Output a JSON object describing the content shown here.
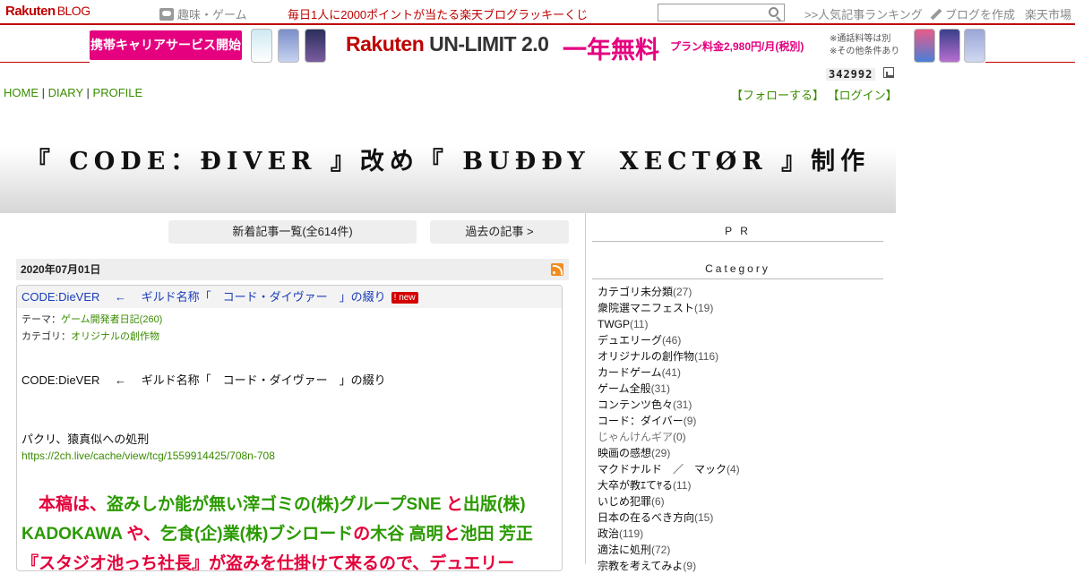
{
  "topbar": {
    "logo_main": "Rakuten",
    "logo_sub": "BLOG",
    "hobby": "趣味・ゲーム",
    "lucky": "毎日1人に2000ポイントが当たる楽天ブログラッキーくじ",
    "search_value": "",
    "ranking": ">>人気記事ランキング",
    "create": "ブログを作成",
    "ichiba": "楽天市場"
  },
  "ad": {
    "tag": "携帯キャリアサービス開始",
    "brand_a": "Rakuten ",
    "brand_b": "UN-LIMIT 2.0",
    "free": "一年無料",
    "price": "プラン料金2,980円/月(税別)",
    "note1": "※通話料等は別",
    "note2": "※その他条件あり"
  },
  "counter": "342992",
  "nav": {
    "home": "HOME",
    "diary": "DIARY",
    "profile": "PROFILE",
    "sep": "|",
    "follow": "【フォローする】",
    "login": "【ログイン】"
  },
  "blog_title": "『 CODE：ÐIVER 』改め『 BUÐÐY　XECTØR 』制作",
  "buttons": {
    "new_posts": "新着記事一覧(全614件)",
    "past_posts": "過去の記事 >"
  },
  "post": {
    "date": "2020年07月01日",
    "title": "CODE:DieVER　 ←　 ギルド名称「　コード・ダイヴァー　」の綴り",
    "new_label": "! new",
    "theme_label": "テーマ：",
    "theme": "ゲーム開発者日記(260)",
    "category_label": "カテゴリ：",
    "category": "オリジナルの創作物",
    "line1": "CODE:DieVER　 ←　 ギルド名称「　コード・ダイヴァー　」の綴り",
    "line2": "パクリ、猿真似への処刑",
    "link": "https://2ch.live/cache/view/tcg/1559914425/708n-708",
    "big_segments": [
      {
        "text": "　本稿は、",
        "color": "red"
      },
      {
        "text": "盗みしか能が無い滓ゴミの(株)グループSNE",
        "color": "green"
      },
      {
        "text": " と",
        "color": "red"
      },
      {
        "text": "出版(株) KADOKAWA",
        "color": "green"
      },
      {
        "text": " や、",
        "color": "red"
      },
      {
        "text": "乞食(企)業(株)ブシロード",
        "color": "green"
      },
      {
        "text": "の",
        "color": "red"
      },
      {
        "text": "木谷 高明",
        "color": "green"
      },
      {
        "text": "と",
        "color": "red"
      },
      {
        "text": "池田 芳正",
        "color": "green"
      },
      {
        "text": "『スタジオ池っち社長』が盗みを仕掛けて来るので、デュエリー",
        "color": "red"
      }
    ]
  },
  "sidebar": {
    "pr": "P R",
    "category_head": "Category",
    "categories": [
      {
        "name": "カテゴリ未分類",
        "count": "(27)"
      },
      {
        "name": "衆院選マニフェスト",
        "count": "(19)"
      },
      {
        "name": "TWGP",
        "count": "(11)"
      },
      {
        "name": "デュエリーグ",
        "count": "(46)"
      },
      {
        "name": "オリジナルの創作物",
        "count": "(116)"
      },
      {
        "name": "カードゲーム",
        "count": "(41)"
      },
      {
        "name": "ゲーム全般",
        "count": "(31)"
      },
      {
        "name": "コンテンツ色々",
        "count": "(31)"
      },
      {
        "name": "コード：ダイバー",
        "count": "(9)"
      },
      {
        "name": "じゃんけんギア",
        "count": "(0)"
      },
      {
        "name": "映画の感想",
        "count": "(29)"
      },
      {
        "name": "マクドナルド　／　マック",
        "count": "(4)"
      },
      {
        "name": "大卒が教ｴてﾔる",
        "count": "(11)"
      },
      {
        "name": "いじめ犯罪",
        "count": "(6)"
      },
      {
        "name": "日本の在るべき方向",
        "count": "(15)"
      },
      {
        "name": "政治",
        "count": "(119)"
      },
      {
        "name": "適法に処刑",
        "count": "(72)"
      },
      {
        "name": "宗教を考えてみよ",
        "count": "(9)"
      }
    ]
  }
}
